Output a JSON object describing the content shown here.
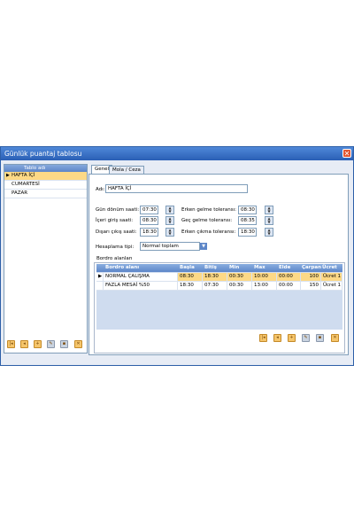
{
  "window": {
    "title": "Günlük puantaj tablosu"
  },
  "left_panel": {
    "header": "Tablo adı",
    "items": [
      {
        "label": "HAFTA İÇİ",
        "selected": true
      },
      {
        "label": "CUMARTESİ",
        "selected": false
      },
      {
        "label": "PAZAR",
        "selected": false
      }
    ],
    "marker": "▶"
  },
  "tabs": [
    {
      "label": "Genel",
      "active": true
    },
    {
      "label": "Mola / Ceza",
      "active": false
    }
  ],
  "form": {
    "name_label": "Adı:",
    "name_value": "HAFTA İÇİ",
    "day_change_label": "Gün dönüm saati:",
    "day_change_value": "07:30",
    "entry_label": "İçeri giriş saati:",
    "entry_value": "08:30",
    "exit_label": "Dışarı çıkış saati:",
    "exit_value": "18:30",
    "early_in_label": "Erken gelme toleransı:",
    "early_in_value": "08:30",
    "late_in_label": "Geç gelme toleransı:",
    "late_in_value": "08:35",
    "early_out_label": "Erken çıkma toleransı:",
    "early_out_value": "18:30",
    "calc_label": "Hesaplama tipi:",
    "calc_value": "Normal toplam"
  },
  "payroll": {
    "group_label": "Bordro alanları",
    "columns": [
      "Bordro alanı",
      "Başla",
      "Bitiş",
      "Min",
      "Max",
      "Elde",
      "Çarpan",
      "Ücret"
    ],
    "rows": [
      {
        "name": "NORMAL ÇALIŞMA",
        "start": "08:30",
        "end": "18:30",
        "min": "00:30",
        "max": "10:00",
        "elde": "00:00",
        "multiplier": "100",
        "fee": "Ücret 1",
        "selected": true
      },
      {
        "name": "FAZLA MESAİ %50",
        "start": "18:30",
        "end": "07:30",
        "min": "00:30",
        "max": "13:00",
        "elde": "00:00",
        "multiplier": "150",
        "fee": "Ücret 1",
        "selected": false
      }
    ]
  },
  "icons": {
    "close": "close-icon",
    "spin": "spin-updown-icon",
    "dropdown": "chevron-down-icon",
    "toolbar": [
      "first-icon",
      "prev-icon",
      "add-icon",
      "edit-icon",
      "save-icon",
      "delete-icon"
    ]
  },
  "colors": {
    "title_bar": "#2a5fb5",
    "selected_row": "#fdd986",
    "header": "#5d86c8",
    "window_bg": "#e7ecf5"
  }
}
